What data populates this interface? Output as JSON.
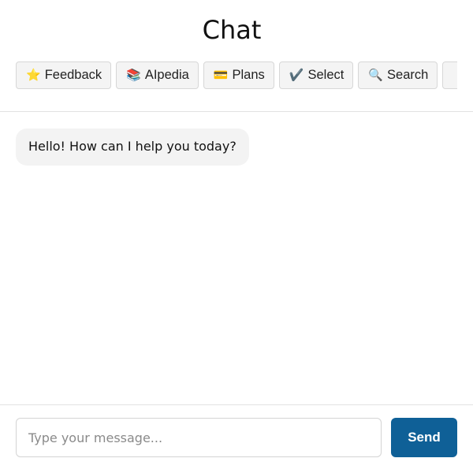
{
  "app": {
    "title": "Chat"
  },
  "toolbar": {
    "buttons": [
      {
        "icon": "star-icon",
        "glyph": "⭐",
        "label": "Feedback"
      },
      {
        "icon": "books-icon",
        "glyph": "📚",
        "label": "AIpedia"
      },
      {
        "icon": "credit-card-icon",
        "glyph": "💳",
        "label": "Plans"
      },
      {
        "icon": "checkmark-icon",
        "glyph": "✔️",
        "label": "Select"
      },
      {
        "icon": "magnifier-icon",
        "glyph": "🔍",
        "label": "Search"
      }
    ]
  },
  "messages": [
    {
      "role": "assistant",
      "text": "Hello! How can I help you today?"
    }
  ],
  "composer": {
    "placeholder": "Type your message...",
    "value": "",
    "send_label": "Send"
  },
  "colors": {
    "send_button": "#0f6097",
    "bubble_background": "#f3f3f3",
    "toolbar_button_background": "#f4f4f4"
  }
}
